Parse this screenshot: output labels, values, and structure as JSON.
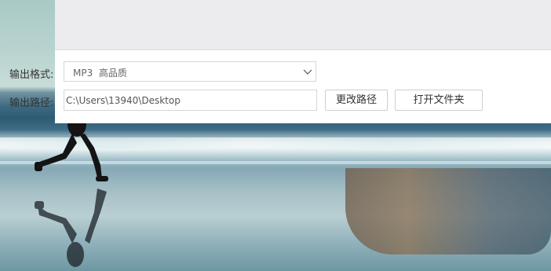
{
  "output_settings": {
    "format_label": "输出格式:",
    "format_value": "MP3  高品质",
    "path_label": "输出路径:",
    "path_value": "C:\\Users\\13940\\Desktop",
    "change_path_button": "更改路径",
    "open_folder_button": "打开文件夹"
  },
  "icons": {
    "dropdown": "chevron-down-icon"
  },
  "colors": {
    "dialog_top": "#ecebee",
    "dialog_body": "#ffffff",
    "border": "#d6d6d6",
    "text": "#333333"
  }
}
